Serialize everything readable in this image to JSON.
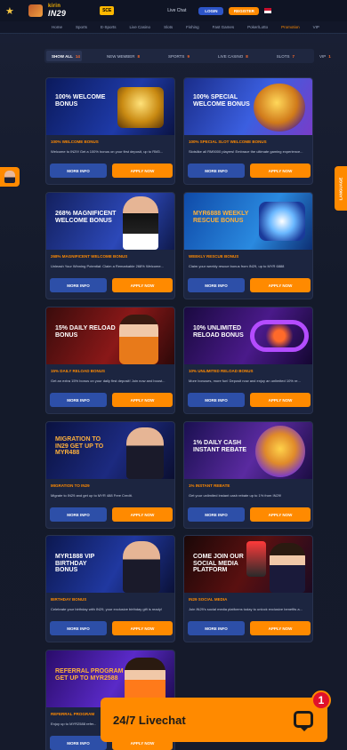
{
  "header": {
    "logo_text": "IN29",
    "logo_sub": "kirin",
    "sce_badge": "SCE",
    "livechat_label": "Live Chat",
    "login_label": "LOGIN",
    "register_label": "REGISTER"
  },
  "nav": {
    "items": [
      "Home",
      "Sports",
      "E-Sports",
      "Live Casino",
      "Slots",
      "Fishing",
      "Fast Games",
      "Poker/Lotto",
      "Promotion",
      "VIP"
    ],
    "active_index": 8
  },
  "filter_tabs": [
    {
      "label": "SHOW ALL",
      "count": "14",
      "active": true
    },
    {
      "label": "NEW MEMBER",
      "count": "8",
      "active": false
    },
    {
      "label": "SPORTS",
      "count": "9",
      "active": false
    },
    {
      "label": "LIVE CASINO",
      "count": "8",
      "active": false
    },
    {
      "label": "SLOTS",
      "count": "7",
      "active": false
    },
    {
      "label": "VIP",
      "count": "1",
      "active": false
    }
  ],
  "side_tab_label": "LANGUAGE",
  "promotions": [
    {
      "banner": "100% WELCOME BONUS",
      "title": "100% WELCOME BONUS",
      "desc": "Welcome to IN29! Get a 100% bonus on your first deposit, up to RM3...",
      "more": "MORE INFO",
      "apply": "APPLY NOW"
    },
    {
      "banner": "100% SPECIAL WELCOME BONUS",
      "title": "100% SPECIAL SLOT WELCOME BONUS",
      "desc": "Slotslike all RM5000 players! Embrace the ultimate gaming experience...",
      "more": "MORE INFO",
      "apply": "APPLY NOW"
    },
    {
      "banner": "268% MAGNIFICENT WELCOME BONUS",
      "title": "268% MAGNIFICENT WELCOME BONUS",
      "desc": "Unleash Your Winning Potential: Claim a Remarkable 268% Welcome...",
      "more": "MORE INFO",
      "apply": "APPLY NOW"
    },
    {
      "banner": "MYR6888 WEEKLY RESCUE BONUS",
      "title": "WEEKLY RESCUE BONUS",
      "desc": "Claim your weekly rescue bonus from IN29, up to MYR 6888",
      "more": "MORE INFO",
      "apply": "APPLY NOW"
    },
    {
      "banner": "15% DAILY RELOAD BONUS",
      "title": "15% DAILY RELOAD BONUS",
      "desc": "Get an extra 15% bonus on your daily first deposit! Join now and boost...",
      "more": "MORE INFO",
      "apply": "APPLY NOW"
    },
    {
      "banner": "10% UNLIMITED RELOAD BONUS",
      "title": "10% UNLIMITED RELOAD BONUS",
      "desc": "More bonuses, more fun! Deposit now and enjoy an unlimited 10% re...",
      "more": "MORE INFO",
      "apply": "APPLY NOW"
    },
    {
      "banner": "MIGRATION TO IN29 GET UP TO MYR488",
      "title": "MIGRATION TO IN29",
      "desc": "Migrate to IN29 and get up to MYR 488 Free Credit.",
      "more": "MORE INFO",
      "apply": "APPLY NOW"
    },
    {
      "banner": "1% DAILY CASH INSTANT REBATE",
      "title": "1% INSTANT REBATE",
      "desc": "Get your unlimited instant cash rebate up to 1% from IN29!",
      "more": "MORE INFO",
      "apply": "APPLY NOW"
    },
    {
      "banner": "MYR1888 VIP BIRTHDAY BONUS",
      "title": "BIRTHDAY BONUS",
      "desc": "Celebrate your birthday with IN29, your exclusive birthday gift is ready!",
      "more": "MORE INFO",
      "apply": "APPLY NOW"
    },
    {
      "banner": "COME JOIN OUR SOCIAL MEDIA PLATFORM",
      "title": "IN29 SOCIAL MEDIA",
      "desc": "Join IN29's social media platforms today to unlock exclusive benefits a...",
      "more": "MORE INFO",
      "apply": "APPLY NOW"
    },
    {
      "banner": "REFERRAL PROGRAM GET UP TO MYR2588",
      "title": "REFERRAL PROGRAM",
      "desc": "Enjoy up to MYR2588 refer...",
      "more": "MORE INFO",
      "apply": "APPLY NOW"
    }
  ],
  "livechat": {
    "label": "24/7 Livechat",
    "badge": "1"
  },
  "colors": {
    "accent": "#ff8a00",
    "primary_button": "#2d4fa8",
    "background": "#151a2b"
  }
}
